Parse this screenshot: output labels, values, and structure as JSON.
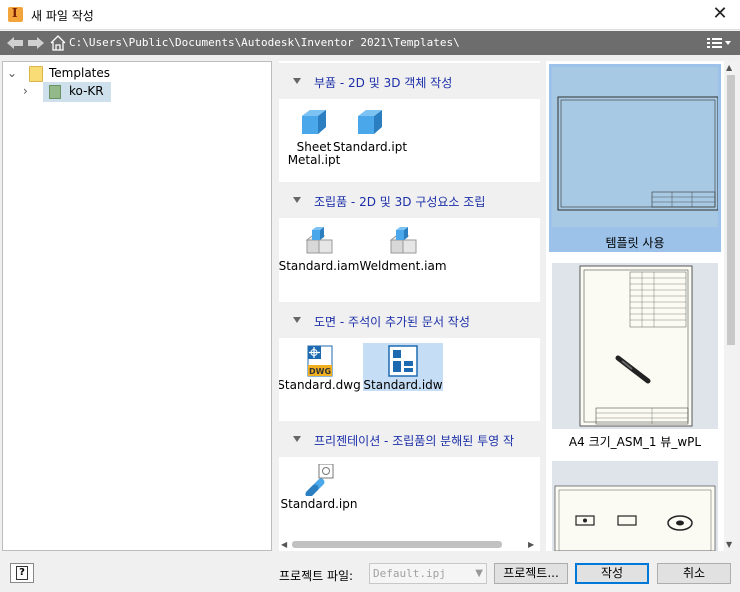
{
  "window": {
    "title": "새 파일 작성",
    "close_glyph": "✕"
  },
  "pathbar": {
    "path": "C:\\Users\\Public\\Documents\\Autodesk\\Inventor 2021\\Templates\\"
  },
  "tree": {
    "root_label": "Templates",
    "child_label": "ko-KR"
  },
  "sections": [
    {
      "title": "부품 - 2D 및 3D 객체 작성",
      "files": [
        "Sheet Metal.ipt",
        "Standard.ipt"
      ]
    },
    {
      "title": "조립품 - 2D 및 3D 구성요소 조립",
      "files": [
        "Standard.iam",
        "Weldment.iam"
      ]
    },
    {
      "title": "도면 - 주석이 추가된 문서 작성",
      "files": [
        "Standard.dwg",
        "Standard.idw"
      ]
    },
    {
      "title": "프리젠테이션 - 조립품의 분해된 투영 작",
      "files": [
        "Standard.ipn"
      ]
    }
  ],
  "file_labels": {
    "sheet_metal_line1": "Sheet",
    "sheet_metal_line2": "Metal.ipt",
    "dwg_badge": "DWG"
  },
  "previews": [
    {
      "caption": "템플릿 사용"
    },
    {
      "caption": "A4 크기_ASM_1 뷰_wPL"
    }
  ],
  "footer": {
    "project_label": "프로젝트 파일:",
    "project_value": "Default.ipj",
    "projects_button": "프로젝트...",
    "create_button": "작성",
    "cancel_button": "취소",
    "help_glyph": "?"
  },
  "colors": {
    "accent": "#0078d7",
    "section_title": "#1c2fa8",
    "selected_bg": "#c5def5"
  }
}
